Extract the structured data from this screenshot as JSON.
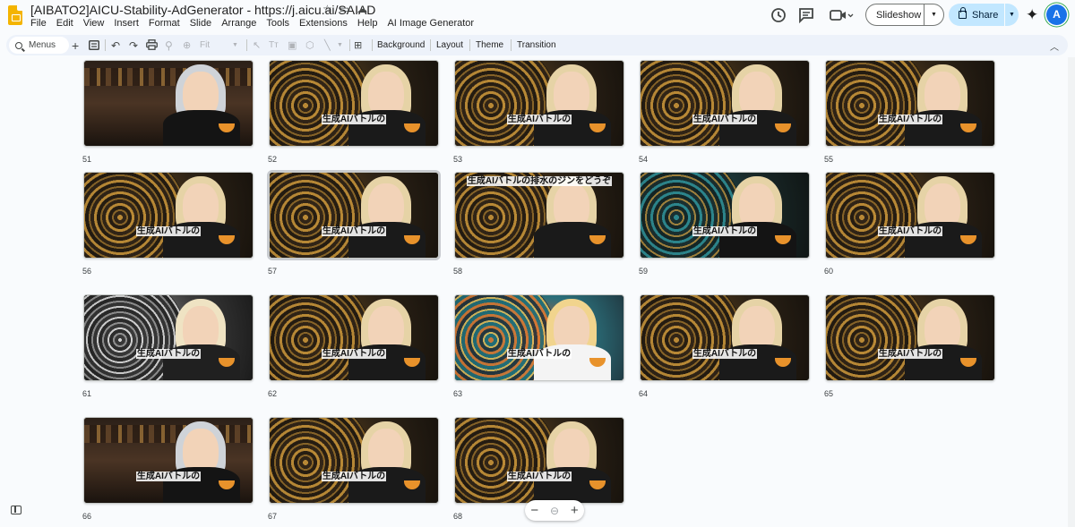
{
  "app": {
    "title": "[AIBATO2]AICU-Stability-AdGenerator - https://j.aicu.ai/SAIAD",
    "menus": [
      "File",
      "Edit",
      "View",
      "Insert",
      "Format",
      "Slide",
      "Arrange",
      "Tools",
      "Extensions",
      "Help",
      "AI Image Generator"
    ],
    "slideshow_label": "Slideshow",
    "share_label": "Share",
    "avatar_letter": "A",
    "colors": {
      "accent": "#1a73e8",
      "share_bg": "#c2e7ff",
      "toolbar_bg": "#edf2fa",
      "brand": "#f4b400"
    }
  },
  "toolbar": {
    "search_label": "Menus",
    "zoom_label": "Fit",
    "background_label": "Background",
    "layout_label": "Layout",
    "theme_label": "Theme",
    "transition_label": "Transition"
  },
  "slides": [
    {
      "num": "51",
      "caption": "",
      "variant": "bar"
    },
    {
      "num": "52",
      "caption": "生成AIバトルの",
      "variant": "gold"
    },
    {
      "num": "53",
      "caption": "生成AIバトルの",
      "variant": "gold"
    },
    {
      "num": "54",
      "caption": "生成AIバトルの",
      "variant": "gold"
    },
    {
      "num": "55",
      "caption": "生成AIバトルの",
      "variant": "gold"
    },
    {
      "num": "56",
      "caption": "生成AIバトルの",
      "variant": "gold"
    },
    {
      "num": "57",
      "caption": "生成AIバトルの",
      "variant": "gold",
      "selected": true
    },
    {
      "num": "58",
      "caption": "生成AIバトルの排水のジンをどうぞ",
      "variant": "gold",
      "caption_top": true
    },
    {
      "num": "59",
      "caption": "生成AIバトルの",
      "variant": "teal"
    },
    {
      "num": "60",
      "caption": "生成AIバトルの",
      "variant": "gold"
    },
    {
      "num": "61",
      "caption": "生成AIバトルの",
      "variant": "silver"
    },
    {
      "num": "62",
      "caption": "生成AIバトルの",
      "variant": "gold"
    },
    {
      "num": "63",
      "caption": "生成AIバトルの",
      "variant": "colorful"
    },
    {
      "num": "64",
      "caption": "生成AIバトルの",
      "variant": "gold"
    },
    {
      "num": "65",
      "caption": "生成AIバトルの",
      "variant": "gold"
    },
    {
      "num": "66",
      "caption": "生成AIバトルの",
      "variant": "bar"
    },
    {
      "num": "67",
      "caption": "生成AIバトルの",
      "variant": "gold"
    },
    {
      "num": "68",
      "caption": "生成AIバトルの",
      "variant": "gold"
    }
  ],
  "zoom_controls": {
    "minus": "−",
    "plus": "+"
  }
}
